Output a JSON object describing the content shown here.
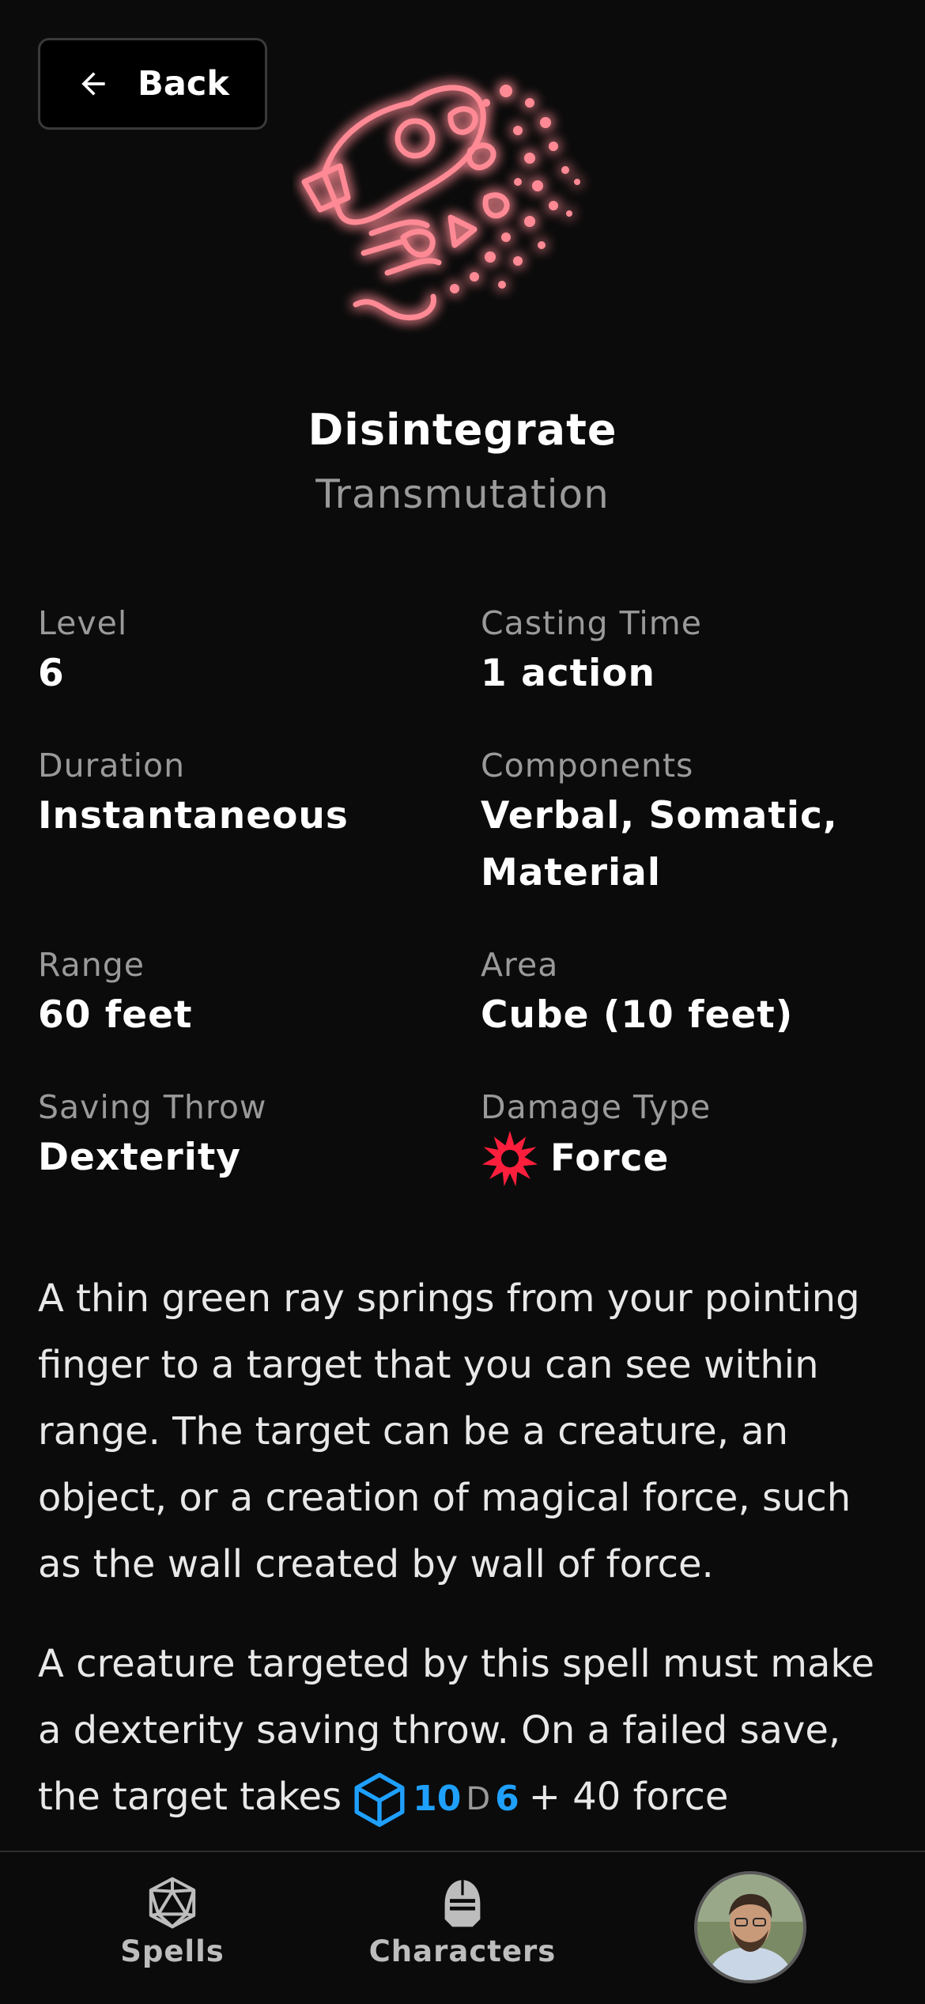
{
  "header": {
    "back_label": "Back"
  },
  "spell": {
    "name": "Disintegrate",
    "school": "Transmutation",
    "stats": {
      "level_label": "Level",
      "level": "6",
      "casting_label": "Casting Time",
      "casting": "1 action",
      "duration_label": "Duration",
      "duration": "Instantaneous",
      "components_label": "Components",
      "components": "Verbal, Somatic, Material",
      "range_label": "Range",
      "range": "60 feet",
      "area_label": "Area",
      "area": "Cube (10 feet)",
      "save_label": "Saving Throw",
      "save": "Dexterity",
      "damage_label": "Damage Type",
      "damage": "Force"
    },
    "description": {
      "p1": "A thin green ray springs from your pointing finger to a target that you can see within range. The target can be a creature, an object, or a creation of magical force, such as the wall created by wall of force.",
      "p2_start": "A creature targeted by this spell must make a dexterity saving throw. On a failed save, the target takes",
      "dice_count": "10",
      "dice_d": "D",
      "dice_sides": "6",
      "p2_end": "+ 40 force"
    }
  },
  "colors": {
    "force": "#ff1f3d",
    "dice": "#1fa0ff",
    "glow": "#ff4a5a"
  },
  "nav": {
    "spells": "Spells",
    "characters": "Characters"
  }
}
